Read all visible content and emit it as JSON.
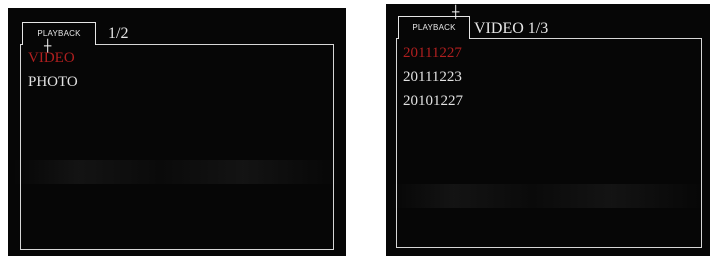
{
  "screens": [
    {
      "tab_label": "PLAYBACK",
      "header": "1/2",
      "items": [
        {
          "label": "VIDEO",
          "selected": true
        },
        {
          "label": "PHOTO",
          "selected": false
        }
      ]
    },
    {
      "tab_label": "PLAYBACK",
      "header": "VIDEO 1/3",
      "items": [
        {
          "label": "20111227",
          "selected": true
        },
        {
          "label": "20111223",
          "selected": false
        },
        {
          "label": "20101227",
          "selected": false
        }
      ]
    }
  ],
  "colors": {
    "screen_background": "#060606",
    "text": "#e2e2e2",
    "selected_text": "#b01f1f",
    "border": "#d6d6d6"
  },
  "icons": {
    "cursor": "crosshair-cursor-icon"
  }
}
